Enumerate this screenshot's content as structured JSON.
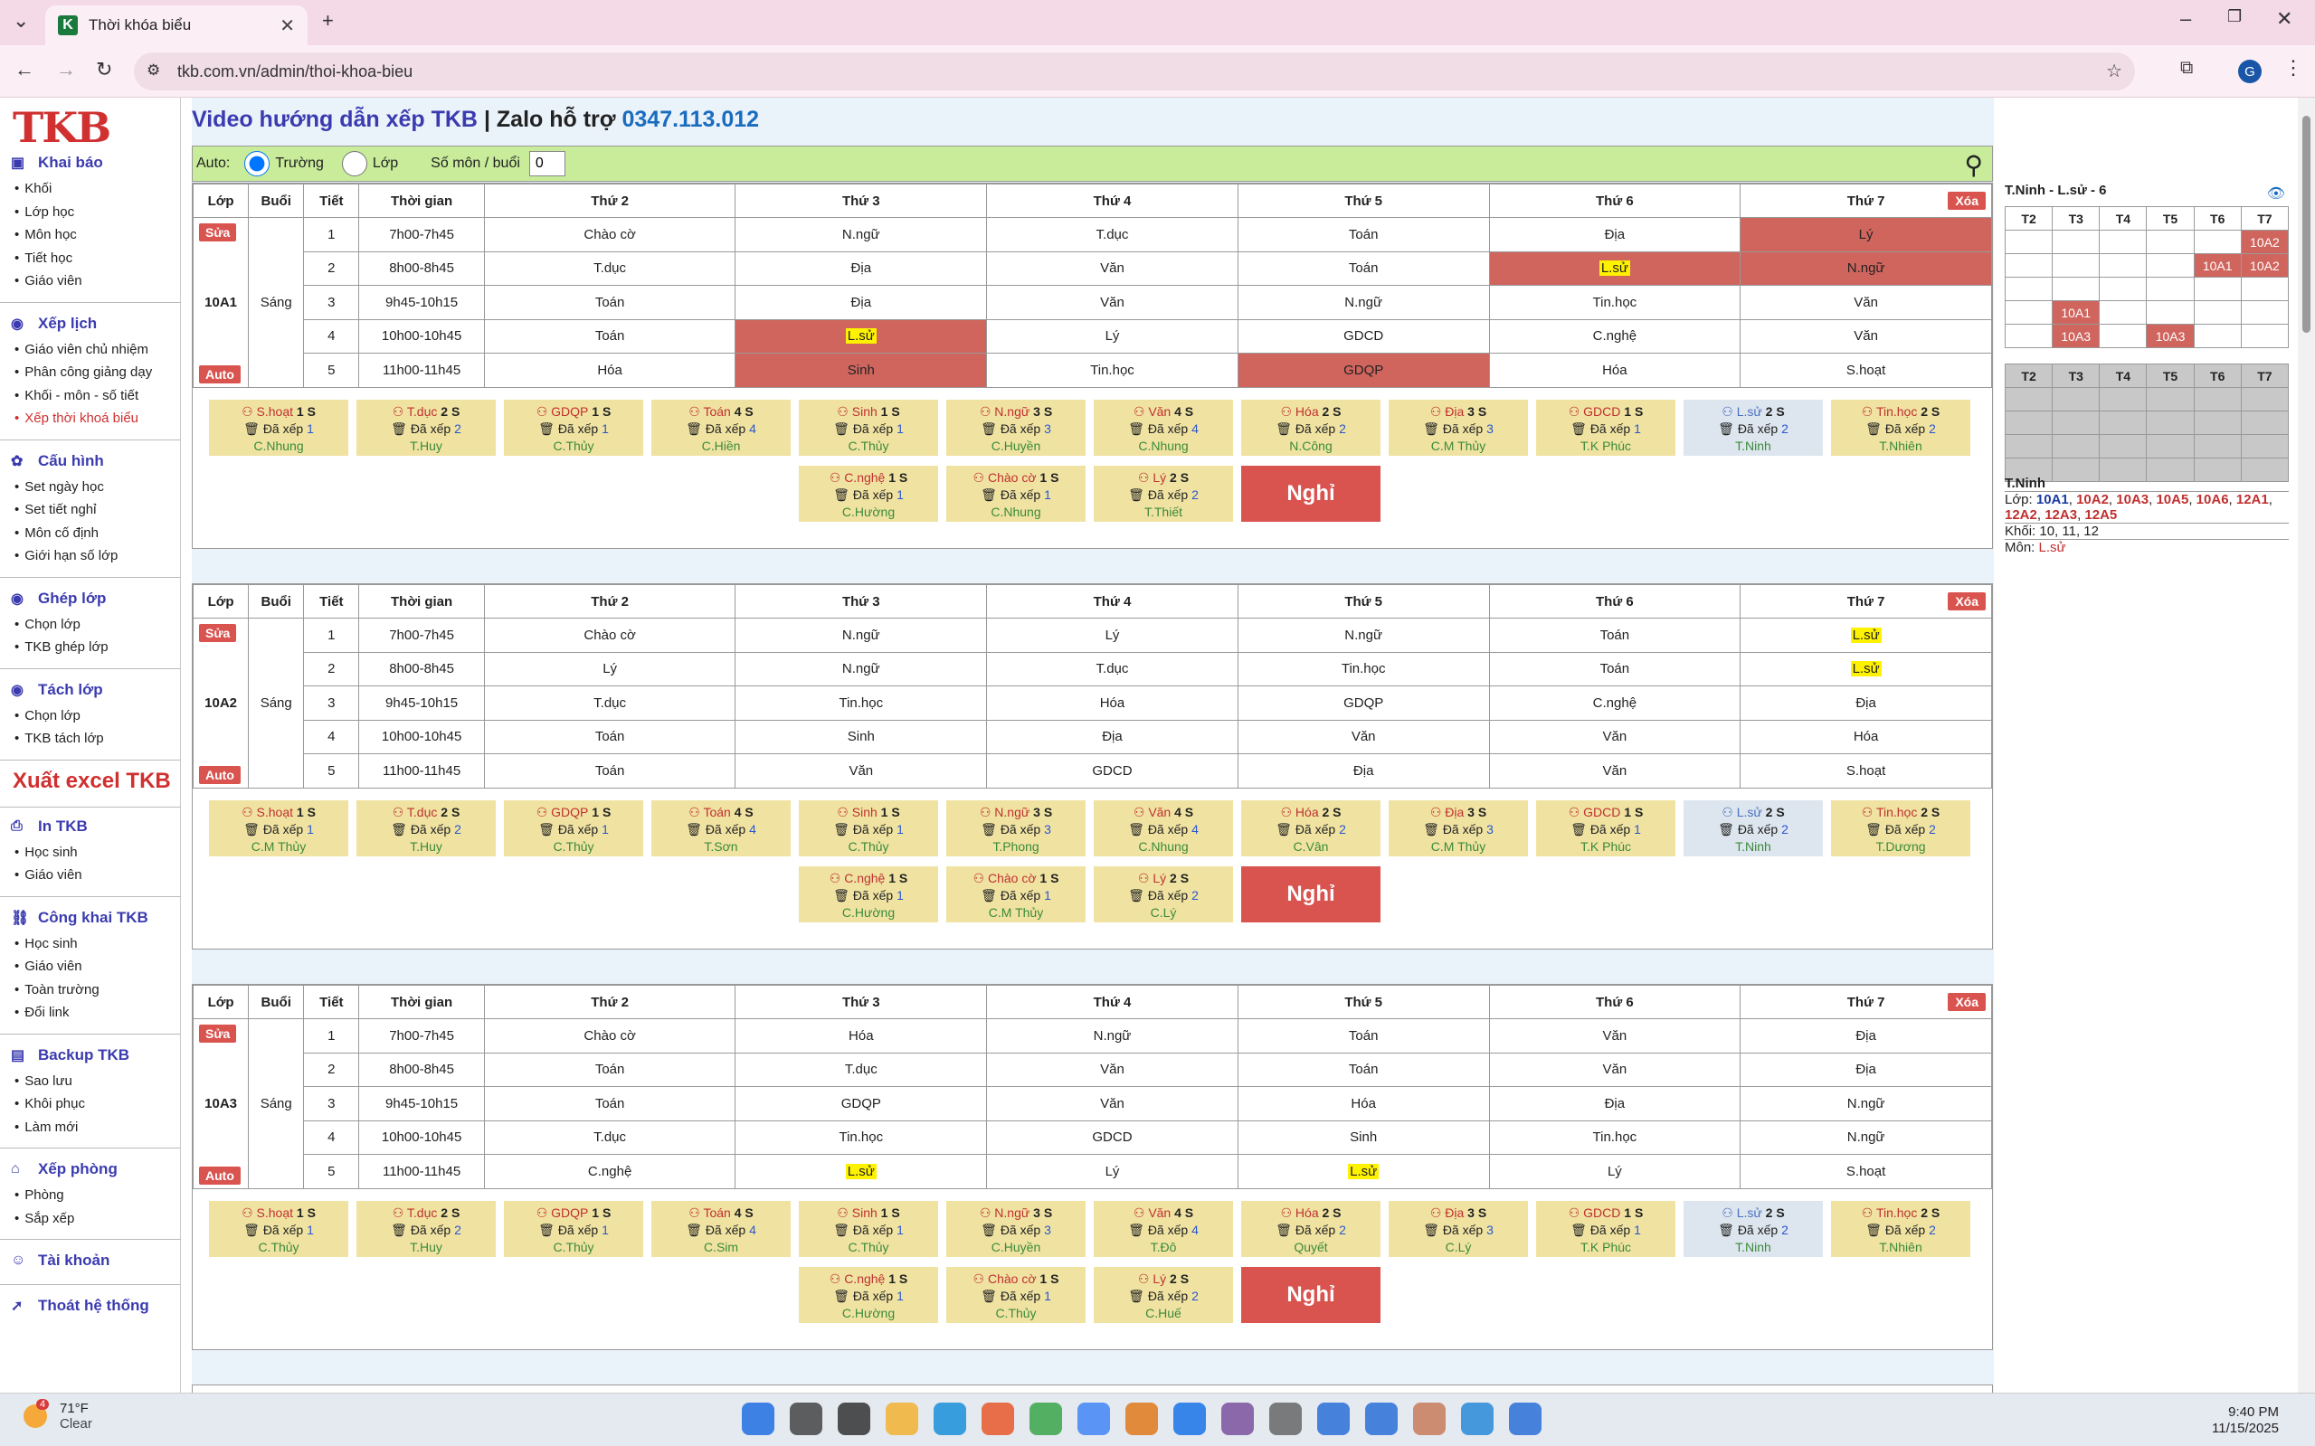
{
  "browser": {
    "tab_title": "Thời khóa biểu",
    "url": "tkb.com.vn/admin/thoi-khoa-bieu",
    "avatar": "G"
  },
  "sidebar": {
    "logo": "TKB",
    "sections": [
      {
        "label": "Khai báo",
        "icon": "calendar-icon",
        "items": [
          "Khối",
          "Lớp học",
          "Môn học",
          "Tiết học",
          "Giáo viên"
        ]
      },
      {
        "label": "Xếp lịch",
        "icon": "check-circle-icon",
        "items": [
          "Giáo viên chủ nhiệm",
          "Phân công giảng dạy",
          "Khối - môn - số tiết",
          "Xếp thời khoá biểu"
        ]
      },
      {
        "label": "Cấu hình",
        "icon": "gear-icon",
        "items": [
          "Set ngày học",
          "Set tiết nghỉ",
          "Môn cố định",
          "Giới hạn số lớp"
        ]
      },
      {
        "label": "Ghép lớp",
        "icon": "check-circle-icon",
        "items": [
          "Chọn lớp",
          "TKB ghép lớp"
        ]
      },
      {
        "label": "Tách lớp",
        "icon": "check-circle-icon",
        "items": [
          "Chọn lớp",
          "TKB tách lớp"
        ]
      },
      {
        "label": "In TKB",
        "icon": "printer-icon",
        "items": [
          "Học sinh",
          "Giáo viên"
        ]
      },
      {
        "label": "Công khai TKB",
        "icon": "link-icon",
        "items": [
          "Học sinh",
          "Giáo viên",
          "Toàn trường",
          "Đổi link"
        ]
      },
      {
        "label": "Backup TKB",
        "icon": "database-icon",
        "items": [
          "Sao lưu",
          "Khôi phục",
          "Làm mới"
        ]
      },
      {
        "label": "Xếp phòng",
        "icon": "building-icon",
        "items": [
          "Phòng",
          "Sắp xếp"
        ]
      },
      {
        "label": "Tài khoản",
        "icon": "user-icon",
        "items": []
      },
      {
        "label": "Thoát hệ thống",
        "icon": "exit-icon",
        "items": []
      }
    ],
    "export_label": "Xuất excel TKB"
  },
  "header": {
    "video": "Video hướng dẫn xếp TKB",
    "sep": " | ",
    "zalo": "Zalo hỗ trợ ",
    "phone": "0347.113.012"
  },
  "filter": {
    "auto": "Auto:",
    "truong": "Trường",
    "lop": "Lớp",
    "so_mon": "Số môn / buổi",
    "so_mon_value": "0"
  },
  "table_headers": [
    "Lớp",
    "Buổi",
    "Tiết",
    "Thời gian",
    "Thứ 2",
    "Thứ 3",
    "Thứ 4",
    "Thứ 5",
    "Thứ 6",
    "Thứ 7"
  ],
  "buttons": {
    "sua": "Sửa",
    "auto": "Auto",
    "xoa": "Xóa",
    "nghi": "Nghỉ"
  },
  "times": [
    "7h00-7h45",
    "8h00-8h45",
    "9h45-10h15",
    "10h00-10h45",
    "11h00-11h45"
  ],
  "classes": [
    {
      "name": "10A1",
      "session": "Sáng",
      "rows": [
        [
          "Chào cờ",
          "N.ngữ",
          "T.dục",
          "Toán",
          "Địa",
          "Lý"
        ],
        [
          "T.dục",
          "Địa",
          "Văn",
          "Toán",
          "L.sử",
          "N.ngữ"
        ],
        [
          "Toán",
          "Địa",
          "Văn",
          "N.ngữ",
          "Tin.học",
          "Văn"
        ],
        [
          "Toán",
          "L.sử",
          "Lý",
          "GDCD",
          "C.nghệ",
          "Văn"
        ],
        [
          "Hóa",
          "Sinh",
          "Tin.học",
          "GDQP",
          "Hóa",
          "S.hoạt"
        ]
      ],
      "red": [
        [
          0,
          5
        ],
        [
          1,
          4
        ],
        [
          1,
          5
        ],
        [
          3,
          1
        ],
        [
          4,
          1
        ],
        [
          4,
          3
        ]
      ],
      "hl": [
        [
          1,
          4
        ],
        [
          3,
          1
        ]
      ],
      "teachers": [
        "C.Nhung",
        "T.Huy",
        "C.Thủy",
        "C.Hiền",
        "C.Thủy",
        "C.Huyền",
        "C.Nhung",
        "N.Công",
        "C.M Thủy",
        "T.K Phúc",
        "T.Ninh",
        "T.Nhiên",
        "C.Hường",
        "C.Nhung",
        "T.Thiết"
      ]
    },
    {
      "name": "10A2",
      "session": "Sáng",
      "rows": [
        [
          "Chào cờ",
          "N.ngữ",
          "Lý",
          "N.ngữ",
          "Toán",
          "L.sử"
        ],
        [
          "Lý",
          "N.ngữ",
          "T.dục",
          "Tin.học",
          "Toán",
          "L.sử"
        ],
        [
          "T.dục",
          "Tin.học",
          "Hóa",
          "GDQP",
          "C.nghệ",
          "Địa"
        ],
        [
          "Toán",
          "Sinh",
          "Địa",
          "Văn",
          "Văn",
          "Hóa"
        ],
        [
          "Toán",
          "Văn",
          "GDCD",
          "Địa",
          "Văn",
          "S.hoạt"
        ]
      ],
      "red": [],
      "hl": [
        [
          0,
          5
        ],
        [
          1,
          5
        ]
      ],
      "teachers": [
        "C.M Thủy",
        "T.Huy",
        "C.Thủy",
        "T.Sơn",
        "C.Thủy",
        "T.Phong",
        "C.Nhung",
        "C.Vân",
        "C.M Thủy",
        "T.K Phúc",
        "T.Ninh",
        "T.Dương",
        "C.Hường",
        "C.M Thủy",
        "C.Lý"
      ]
    },
    {
      "name": "10A3",
      "session": "Sáng",
      "rows": [
        [
          "Chào cờ",
          "Hóa",
          "N.ngữ",
          "Toán",
          "Văn",
          "Địa"
        ],
        [
          "Toán",
          "T.dục",
          "Văn",
          "Toán",
          "Văn",
          "Địa"
        ],
        [
          "Toán",
          "GDQP",
          "Văn",
          "Hóa",
          "Địa",
          "N.ngữ"
        ],
        [
          "T.dục",
          "Tin.học",
          "GDCD",
          "Sinh",
          "Tin.học",
          "N.ngữ"
        ],
        [
          "C.nghệ",
          "L.sử",
          "Lý",
          "L.sử",
          "Lý",
          "S.hoạt"
        ]
      ],
      "red": [],
      "hl": [
        [
          4,
          1
        ],
        [
          4,
          3
        ]
      ],
      "teachers": [
        "C.Thủy",
        "T.Huy",
        "C.Thủy",
        "C.Sim",
        "C.Thủy",
        "C.Huyền",
        "T.Đô",
        "Quyết",
        "C.Lý",
        "T.K Phúc",
        "T.Ninh",
        "T.Nhiên",
        "C.Hường",
        "C.Thủy",
        "C.Huế"
      ]
    }
  ],
  "subjects": [
    {
      "name": "S.hoạt",
      "count": "1",
      "placed": "1"
    },
    {
      "name": "T.dục",
      "count": "2",
      "placed": "2"
    },
    {
      "name": "GDQP",
      "count": "1",
      "placed": "1"
    },
    {
      "name": "Toán",
      "count": "4",
      "placed": "4"
    },
    {
      "name": "Sinh",
      "count": "1",
      "placed": "1"
    },
    {
      "name": "N.ngữ",
      "count": "3",
      "placed": "3"
    },
    {
      "name": "Văn",
      "count": "4",
      "placed": "4"
    },
    {
      "name": "Hóa",
      "count": "2",
      "placed": "2"
    },
    {
      "name": "Địa",
      "count": "3",
      "placed": "3"
    },
    {
      "name": "GDCD",
      "count": "1",
      "placed": "1"
    },
    {
      "name": "L.sử",
      "count": "2",
      "placed": "2"
    },
    {
      "name": "Tin.học",
      "count": "2",
      "placed": "2"
    },
    {
      "name": "C.nghệ",
      "count": "1",
      "placed": "1"
    },
    {
      "name": "Chào cờ",
      "count": "1",
      "placed": "1"
    },
    {
      "name": "Lý",
      "count": "2",
      "placed": "2"
    }
  ],
  "card_labels": {
    "s": " S",
    "placed": "Đã xếp "
  },
  "right_panel": {
    "title": "T.Ninh - L.sử - 6",
    "days": [
      "T2",
      "T3",
      "T4",
      "T5",
      "T6",
      "T7"
    ],
    "grid": [
      [
        "",
        "",
        "",
        "",
        "",
        "10A2"
      ],
      [
        "",
        "",
        "",
        "",
        "10A1",
        "10A2"
      ],
      [
        "",
        "",
        "",
        "",
        "",
        ""
      ],
      [
        "",
        "10A1",
        "",
        "",
        "",
        ""
      ],
      [
        "",
        "10A3",
        "",
        "10A3",
        "",
        ""
      ]
    ],
    "teacher": "T.Ninh",
    "lop_label": "Lớp: ",
    "lop_list": [
      "10A1",
      "10A2",
      "10A3",
      "10A5",
      "10A6",
      "12A1",
      "12A2",
      "12A3",
      "12A5"
    ],
    "khoi": "Khối: 10, 11, 12",
    "mon_label": "Môn: ",
    "mon": "L.sử"
  },
  "taskbar": {
    "temp": "71°F",
    "weather": "Clear",
    "time": "9:40 PM",
    "date": "11/15/2025",
    "badge": "4"
  },
  "colors": {
    "accent": "#3b3bb0",
    "red": "#d0655e",
    "button_red": "#d9534f",
    "card": "#f0e3a2",
    "filter": "#c8ec9a"
  }
}
